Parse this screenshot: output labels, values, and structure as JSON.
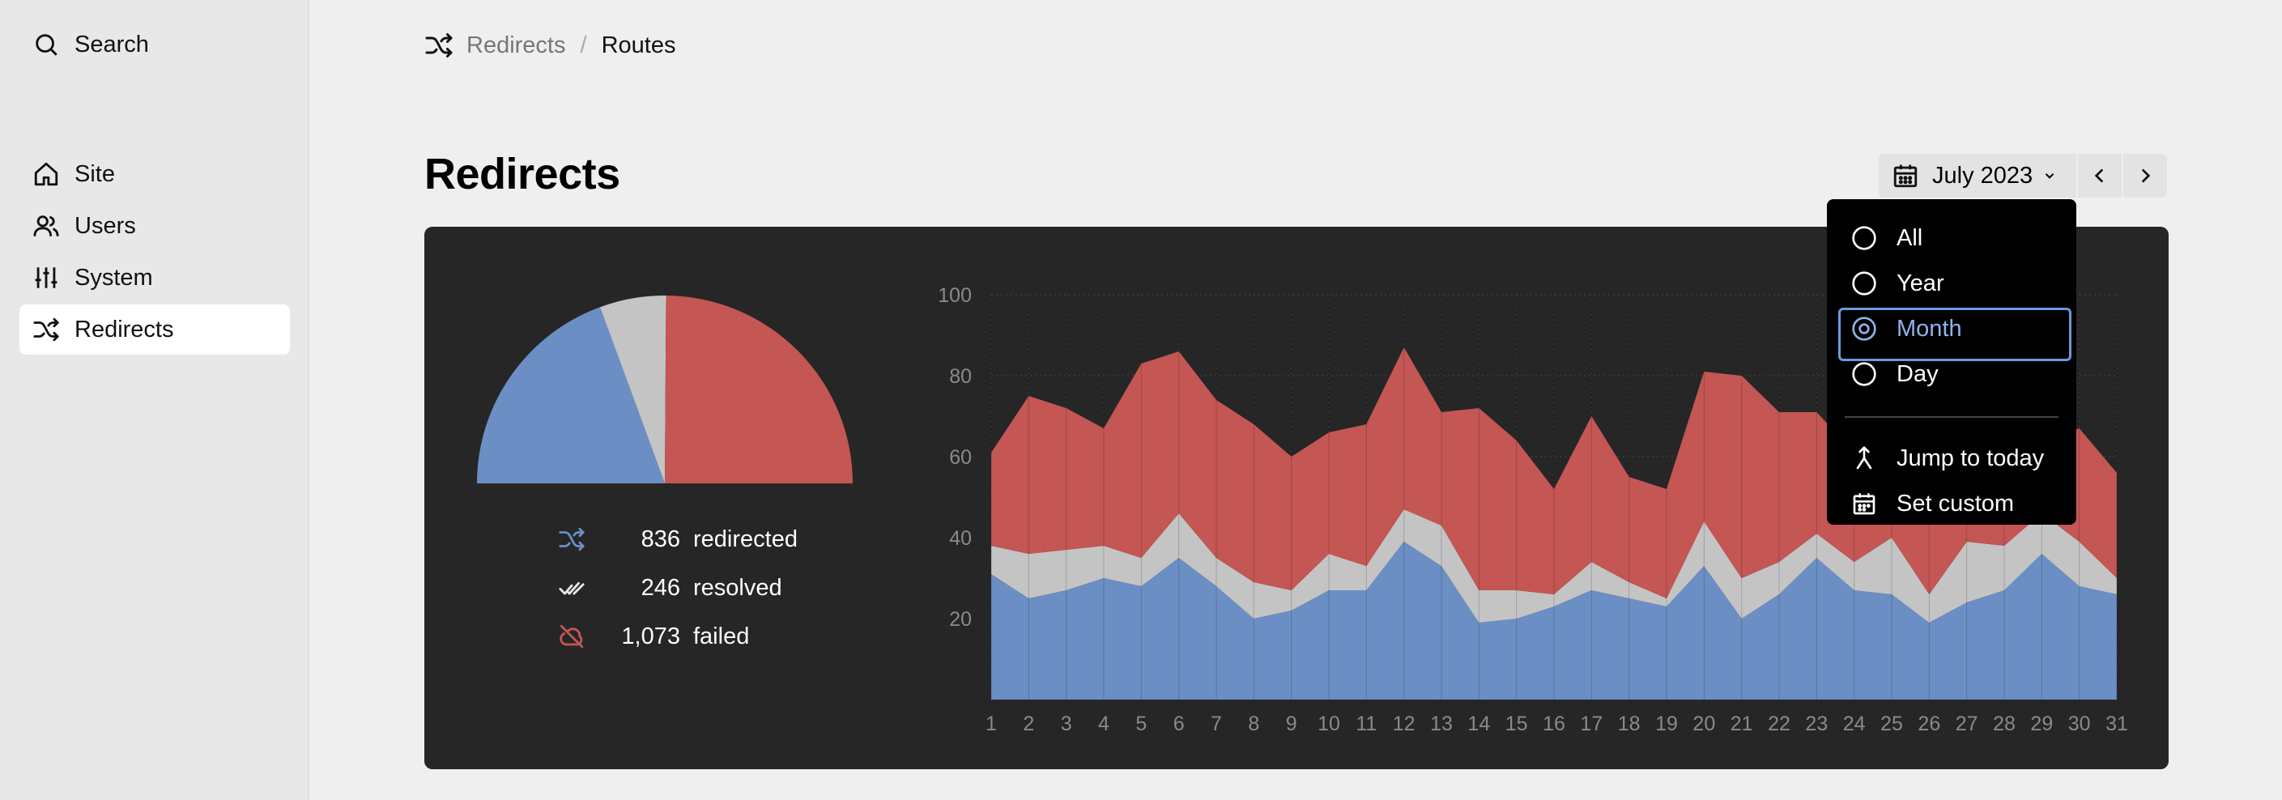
{
  "sidebar": {
    "search_label": "Search",
    "items": [
      {
        "label": "Site",
        "icon": "home-icon"
      },
      {
        "label": "Users",
        "icon": "users-icon"
      },
      {
        "label": "System",
        "icon": "sliders-icon"
      },
      {
        "label": "Redirects",
        "icon": "shuffle-icon",
        "active": true
      }
    ]
  },
  "breadcrumb": {
    "parent": "Redirects",
    "separator": "/",
    "current": "Routes"
  },
  "page": {
    "title": "Redirects"
  },
  "date_picker": {
    "value": "July 2023"
  },
  "period_menu": {
    "options": [
      "All",
      "Year",
      "Month",
      "Day"
    ],
    "selected": "Month",
    "actions": [
      {
        "label": "Jump to today",
        "icon": "jump-icon"
      },
      {
        "label": "Set custom",
        "icon": "calendar-icon"
      }
    ]
  },
  "colors": {
    "redirected": "#6b8fc4",
    "resolved": "#c4c4c4",
    "failed": "#c45654",
    "panel": "#262626",
    "focus": "#6b9ae0"
  },
  "stats": [
    {
      "value": "836",
      "label": "redirected",
      "icon": "shuffle-icon"
    },
    {
      "value": "246",
      "label": "resolved",
      "icon": "double-check-icon"
    },
    {
      "value": "1,073",
      "label": "failed",
      "icon": "cloud-off-icon"
    }
  ],
  "chart_data": [
    {
      "type": "pie",
      "half": true,
      "slices": [
        {
          "name": "redirected",
          "value": 836
        },
        {
          "name": "resolved",
          "value": 246
        },
        {
          "name": "failed",
          "value": 1073
        }
      ]
    },
    {
      "type": "area",
      "stacked": true,
      "x": [
        1,
        2,
        3,
        4,
        5,
        6,
        7,
        8,
        9,
        10,
        11,
        12,
        13,
        14,
        15,
        16,
        17,
        18,
        19,
        20,
        21,
        22,
        23,
        24,
        25,
        26,
        27,
        28,
        29,
        30,
        31
      ],
      "ylim": [
        0,
        100
      ],
      "yticks": [
        20,
        40,
        60,
        80,
        100
      ],
      "grid": true,
      "series": [
        {
          "name": "redirected",
          "values": [
            31,
            25,
            27,
            30,
            28,
            35,
            28,
            20,
            22,
            27,
            27,
            39,
            33,
            19,
            20,
            23,
            27,
            25,
            23,
            33,
            20,
            26,
            35,
            27,
            26,
            19,
            24,
            27,
            36,
            28,
            26
          ]
        },
        {
          "name": "resolved",
          "values": [
            7,
            11,
            10,
            8,
            7,
            11,
            7,
            9,
            5,
            9,
            6,
            8,
            10,
            8,
            7,
            3,
            7,
            4,
            2,
            11,
            10,
            8,
            6,
            7,
            14,
            7,
            15,
            11,
            10,
            11,
            4
          ]
        },
        {
          "name": "failed",
          "values": [
            23,
            39,
            35,
            29,
            48,
            40,
            39,
            39,
            33,
            30,
            35,
            40,
            28,
            45,
            37,
            26,
            36,
            26,
            27,
            37,
            50,
            37,
            30,
            27,
            26,
            48,
            24,
            26,
            18,
            28,
            26
          ]
        }
      ]
    }
  ]
}
